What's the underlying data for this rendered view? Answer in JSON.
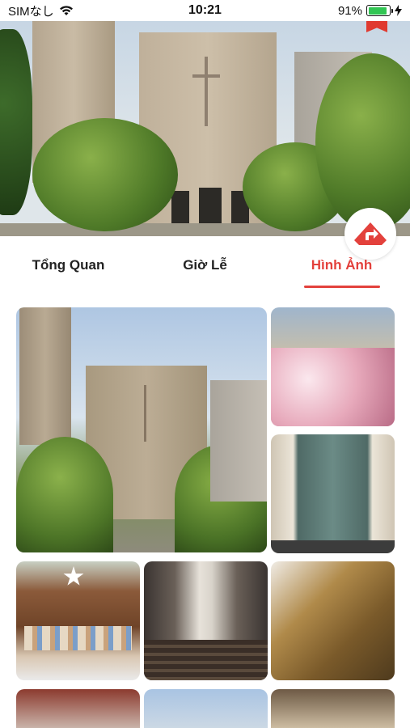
{
  "status_bar": {
    "carrier": "SIMなし",
    "time": "10:21",
    "battery": "91%",
    "battery_level": 0.91
  },
  "hero": {
    "image_icon": "church-photo",
    "bookmark_icon": "bookmark-icon",
    "directions_icon": "directions-icon"
  },
  "tabs": [
    {
      "label": "Tổng Quan",
      "active": false
    },
    {
      "label": "Giờ Lễ",
      "active": false
    },
    {
      "label": "Hình Ảnh",
      "active": true
    }
  ],
  "colors": {
    "accent": "#e3413c",
    "battery_green": "#31c553"
  }
}
